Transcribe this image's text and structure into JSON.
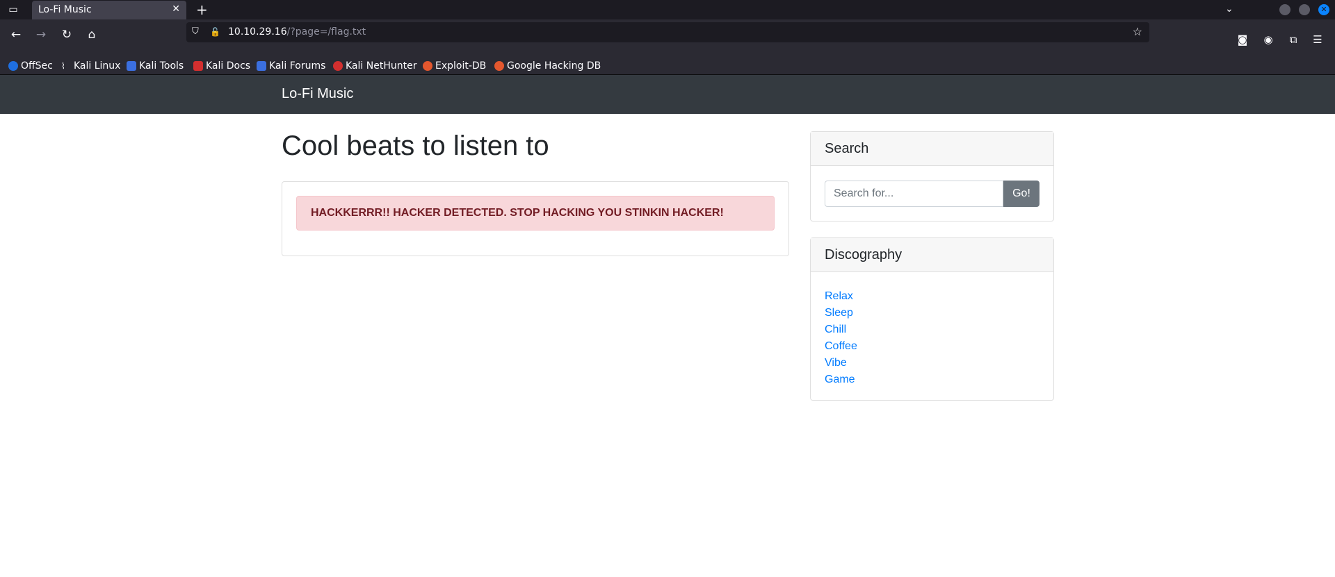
{
  "browser": {
    "tab_title": "Lo-Fi Music",
    "url_host": "10.10.29.16",
    "url_path": "/?page=/flag.txt",
    "bookmarks": [
      {
        "label": "OffSec",
        "color": "#1f6fe0"
      },
      {
        "label": "Kali Linux",
        "color": "#2b2a33"
      },
      {
        "label": "Kali Tools",
        "color": "#3b6fe0"
      },
      {
        "label": "Kali Docs",
        "color": "#d32f2f"
      },
      {
        "label": "Kali Forums",
        "color": "#3b6fe0"
      },
      {
        "label": "Kali NetHunter",
        "color": "#d32f2f"
      },
      {
        "label": "Exploit-DB",
        "color": "#e4572e"
      },
      {
        "label": "Google Hacking DB",
        "color": "#e4572e"
      }
    ]
  },
  "site": {
    "brand": "Lo-Fi Music",
    "heading": "Cool beats to listen to",
    "alert": "HACKKERRR!! HACKER DETECTED. STOP HACKING YOU STINKIN HACKER!"
  },
  "search": {
    "title": "Search",
    "placeholder": "Search for...",
    "button": "Go!"
  },
  "discography": {
    "title": "Discography",
    "items": [
      "Relax",
      "Sleep",
      "Chill",
      "Coffee",
      "Vibe",
      "Game"
    ]
  },
  "colors": {
    "navbar": "#343a40",
    "alert_bg": "#f8d7da",
    "alert_text": "#721c24",
    "link": "#007bff",
    "button": "#6c757d"
  }
}
